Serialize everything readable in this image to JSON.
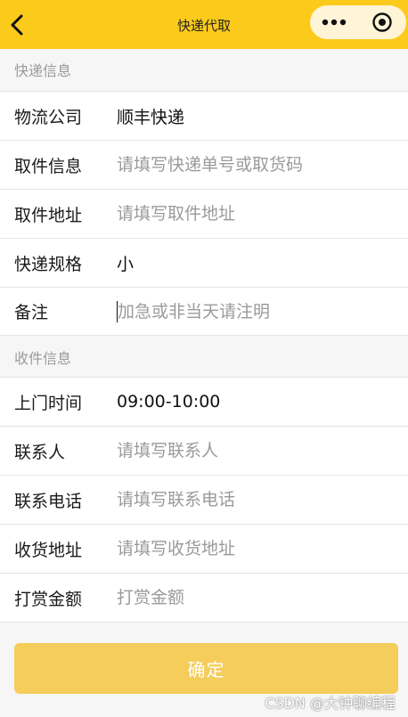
{
  "navbar": {
    "title": "快递代取",
    "back_icon": "chevron-left-icon",
    "menu_icon": "more-dots-icon",
    "close_icon": "target-circle-icon",
    "color": "#fcca1b"
  },
  "sections": {
    "express": {
      "title": "快递信息"
    },
    "receiver": {
      "title": "收件信息"
    }
  },
  "fields": {
    "company": {
      "label": "物流公司",
      "value": "顺丰快递"
    },
    "pickup_info": {
      "label": "取件信息",
      "placeholder": "请填写快递单号或取货码"
    },
    "pickup_address": {
      "label": "取件地址",
      "placeholder": "请填写取件地址"
    },
    "size": {
      "label": "快递规格",
      "value": "小"
    },
    "note": {
      "label": "备注",
      "placeholder": "加急或非当天请注明"
    },
    "time": {
      "label": "上门时间",
      "value": "09:00-10:00"
    },
    "contact": {
      "label": "联系人",
      "placeholder": "请填写联系人"
    },
    "phone": {
      "label": "联系电话",
      "placeholder": "请填写联系电话"
    },
    "delivery_address": {
      "label": "收货地址",
      "placeholder": "请填写收货地址"
    },
    "reward": {
      "label": "打赏金额",
      "placeholder": "打赏金额"
    }
  },
  "actions": {
    "confirm_label": "确定",
    "confirm_color": "#f4cd5b"
  },
  "watermark": "CSDN @大钟聊编程"
}
